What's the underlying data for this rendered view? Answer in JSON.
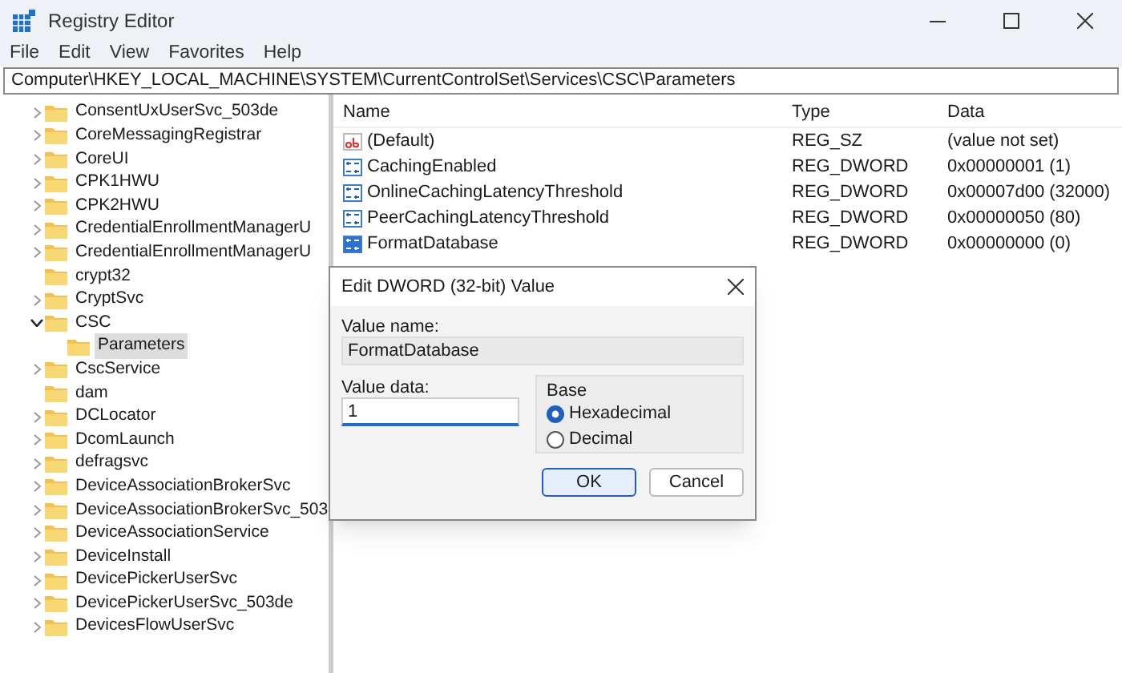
{
  "window": {
    "title": "Registry Editor"
  },
  "menu": [
    "File",
    "Edit",
    "View",
    "Favorites",
    "Help"
  ],
  "address": "Computer\\HKEY_LOCAL_MACHINE\\SYSTEM\\CurrentControlSet\\Services\\CSC\\Parameters",
  "tree": [
    {
      "label": "ConsentUxUserSvc_503de",
      "expandable": true,
      "expanded": false,
      "selected": false
    },
    {
      "label": "CoreMessagingRegistrar",
      "expandable": true,
      "expanded": false,
      "selected": false
    },
    {
      "label": "CoreUI",
      "expandable": true,
      "expanded": false,
      "selected": false
    },
    {
      "label": "CPK1HWU",
      "expandable": true,
      "expanded": false,
      "selected": false
    },
    {
      "label": "CPK2HWU",
      "expandable": true,
      "expanded": false,
      "selected": false
    },
    {
      "label": "CredentialEnrollmentManagerU",
      "expandable": true,
      "expanded": false,
      "selected": false
    },
    {
      "label": "CredentialEnrollmentManagerU",
      "expandable": true,
      "expanded": false,
      "selected": false
    },
    {
      "label": "crypt32",
      "expandable": false,
      "expanded": false,
      "selected": false
    },
    {
      "label": "CryptSvc",
      "expandable": true,
      "expanded": false,
      "selected": false
    },
    {
      "label": "CSC",
      "expandable": true,
      "expanded": true,
      "selected": false,
      "children": [
        {
          "label": "Parameters",
          "expandable": false,
          "expanded": false,
          "selected": true
        }
      ]
    },
    {
      "label": "CscService",
      "expandable": true,
      "expanded": false,
      "selected": false
    },
    {
      "label": "dam",
      "expandable": false,
      "expanded": false,
      "selected": false
    },
    {
      "label": "DCLocator",
      "expandable": true,
      "expanded": false,
      "selected": false
    },
    {
      "label": "DcomLaunch",
      "expandable": true,
      "expanded": false,
      "selected": false
    },
    {
      "label": "defragsvc",
      "expandable": true,
      "expanded": false,
      "selected": false
    },
    {
      "label": "DeviceAssociationBrokerSvc",
      "expandable": true,
      "expanded": false,
      "selected": false
    },
    {
      "label": "DeviceAssociationBrokerSvc_503",
      "expandable": true,
      "expanded": false,
      "selected": false
    },
    {
      "label": "DeviceAssociationService",
      "expandable": true,
      "expanded": false,
      "selected": false
    },
    {
      "label": "DeviceInstall",
      "expandable": true,
      "expanded": false,
      "selected": false
    },
    {
      "label": "DevicePickerUserSvc",
      "expandable": true,
      "expanded": false,
      "selected": false
    },
    {
      "label": "DevicePickerUserSvc_503de",
      "expandable": true,
      "expanded": false,
      "selected": false
    },
    {
      "label": "DevicesFlowUserSvc",
      "expandable": true,
      "expanded": false,
      "selected": false
    }
  ],
  "columns": [
    "Name",
    "Type",
    "Data"
  ],
  "values": [
    {
      "kind": "string",
      "name": "(Default)",
      "type": "REG_SZ",
      "data": "(value not set)",
      "selected": false
    },
    {
      "kind": "dword",
      "name": "CachingEnabled",
      "type": "REG_DWORD",
      "data": "0x00000001 (1)",
      "selected": false
    },
    {
      "kind": "dword",
      "name": "OnlineCachingLatencyThreshold",
      "type": "REG_DWORD",
      "data": "0x00007d00 (32000)",
      "selected": false
    },
    {
      "kind": "dword",
      "name": "PeerCachingLatencyThreshold",
      "type": "REG_DWORD",
      "data": "0x00000050 (80)",
      "selected": false
    },
    {
      "kind": "dword",
      "name": "FormatDatabase",
      "type": "REG_DWORD",
      "data": "0x00000000 (0)",
      "selected": true
    }
  ],
  "dialog": {
    "title": "Edit DWORD (32-bit) Value",
    "value_name_label": "Value name:",
    "value_name": "FormatDatabase",
    "value_data_label": "Value data:",
    "value_data": "1",
    "base_label": "Base",
    "base_options": [
      {
        "label": "Hexadecimal",
        "selected": true
      },
      {
        "label": "Decimal",
        "selected": false
      }
    ],
    "buttons": [
      {
        "label": "OK",
        "default": true
      },
      {
        "label": "Cancel",
        "default": false
      }
    ]
  }
}
